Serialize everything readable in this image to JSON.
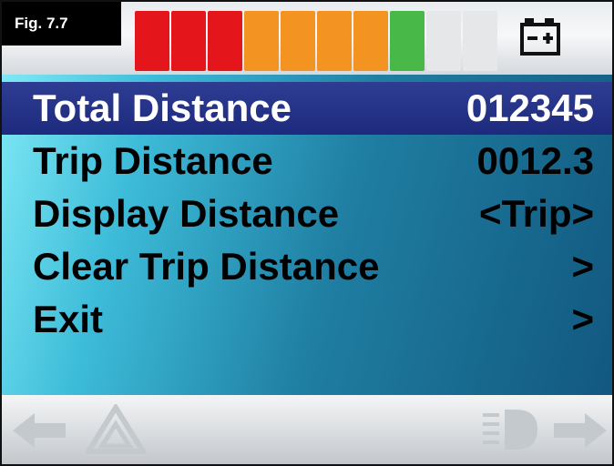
{
  "figure_label": "Fig. 7.7",
  "battery": {
    "icon": "battery-icon",
    "level": 0.7,
    "segments": [
      "#e4161b",
      "#e4161b",
      "#e4161b",
      "#f39322",
      "#f39322",
      "#f39322",
      "#f39322",
      "#48b848",
      "#e5e7e9",
      "#e5e7e9"
    ]
  },
  "menu": {
    "items": [
      {
        "label": "Total Distance",
        "value": "012345",
        "selected": true
      },
      {
        "label": "Trip Distance",
        "value": "0012.3",
        "selected": false
      },
      {
        "label": "Display Distance",
        "value": "<Trip>",
        "selected": false
      },
      {
        "label": "Clear Trip Distance",
        "value": ">",
        "selected": false
      },
      {
        "label": "Exit",
        "value": ">",
        "selected": false
      }
    ]
  },
  "bottom_icons": [
    "left-arrow-icon",
    "hazard-warning-icon",
    "headlight-icon",
    "right-arrow-icon"
  ]
}
